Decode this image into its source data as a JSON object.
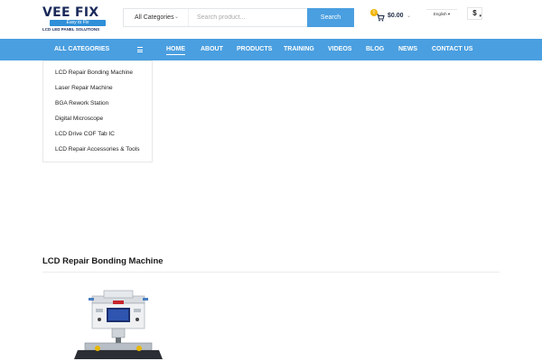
{
  "logo": {
    "brand": "VEE FIX",
    "strip": "Easy to Fix",
    "tagline": "LCD LED PANEL SOLUTIONS"
  },
  "search": {
    "category_label": "All Categories",
    "placeholder": "Search product...",
    "button_label": "Search"
  },
  "cart": {
    "count": "0",
    "total": "$0.00"
  },
  "language": "English ▾",
  "currency": "$",
  "nav": {
    "all_categories": "ALL CATEGORIES",
    "items": [
      {
        "label": "HOME",
        "active": true
      },
      {
        "label": "ABOUT",
        "active": false
      },
      {
        "label": "PRODUCTS",
        "active": false
      },
      {
        "label": "TRAINING",
        "active": false
      },
      {
        "label": "VIDEOS",
        "active": false
      },
      {
        "label": "BLOG",
        "active": false
      },
      {
        "label": "NEWS",
        "active": false
      },
      {
        "label": "CONTACT US",
        "active": false
      }
    ]
  },
  "categories": [
    "LCD Repair Bonding Machine",
    "Laser Repair Machine",
    "BGA Rework Station",
    "Digital Microscope",
    "LCD Drive COF Tab IC",
    "LCD Repair Accessories & Tools"
  ],
  "section": {
    "title": "LCD Repair Bonding Machine"
  },
  "colors": {
    "accent": "#4a9fe0",
    "badge": "#f0b400",
    "text_dark": "#1e2a44"
  }
}
